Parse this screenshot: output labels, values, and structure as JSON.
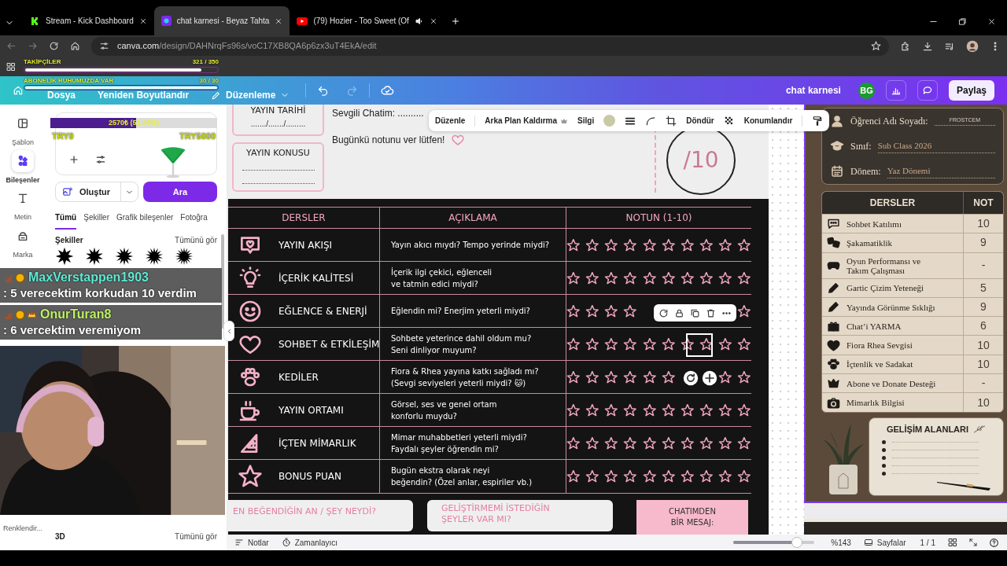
{
  "browser": {
    "tabs": [
      {
        "title": "Stream - Kick Dashboard",
        "selected": false,
        "audio": false
      },
      {
        "title": "chat karnesi - Beyaz Tahta",
        "selected": true,
        "audio": false
      },
      {
        "title": "(79) Hozier - Too Sweet (Of",
        "selected": false,
        "audio": true
      }
    ],
    "url_host": "canva.com",
    "url_path": "/design/DAHNrqFs96s/voC17XB8QA6p6zx3uT4EkA/edit"
  },
  "header": {
    "menu": [
      "Dosya",
      "Yeniden Boyutlandır",
      "Düzenleme"
    ],
    "design_title": "chat karnesi",
    "avatar": "BG",
    "share": "Paylaş"
  },
  "sidebar": {
    "items": [
      {
        "label": "Şablon",
        "selected": false
      },
      {
        "label": "Bileşenler",
        "selected": true
      },
      {
        "label": "Metin",
        "selected": false
      },
      {
        "label": "Marka",
        "selected": false
      },
      {
        "label": "Renklendir...",
        "selected": false
      }
    ]
  },
  "panel": {
    "create": "Oluştur",
    "search": "Ara",
    "tabs": [
      {
        "label": "Tümü",
        "selected": true
      },
      {
        "label": "Şekiller",
        "selected": false
      },
      {
        "label": "Grafik bileşenler",
        "selected": false
      },
      {
        "label": "Fotoğra",
        "selected": false
      }
    ],
    "sections": [
      {
        "title": "Şekiller",
        "link": "Tümünü gör"
      },
      {
        "title": "3D",
        "link": "Tümünü gör"
      }
    ]
  },
  "toolbar": {
    "items": [
      "Düzenle",
      "Arka Plan Kaldırma",
      "Silgi",
      "Döndür",
      "Konumlandır"
    ]
  },
  "sheet": {
    "date_label": "YAYIN TARİHİ",
    "date_blank": "......./......./.........",
    "topic_label": "YAYIN KONUSU",
    "greeting": "Sevgili Chatim: ..........",
    "prompt": "Bugünkü notunu ver lütfen!",
    "score": "/10",
    "columns": [
      "DERSLER",
      "AÇIKLAMA",
      "NOTUN (1-10)"
    ],
    "rows": [
      {
        "title": "YAYIN AKIŞI",
        "description": "Yayın akıcı mıydı? Tempo yerinde miydi?"
      },
      {
        "title": "İÇERİK KALİTESİ",
        "description": "İçerik ilgi çekici, eğlenceli\nve tatmin edici miydi?"
      },
      {
        "title": "EĞLENCE & ENERJİ",
        "description": "Eğlendin mi? Enerjim yeterli miydi?"
      },
      {
        "title": "SOHBET & ETKİLEŞİM",
        "description": "Sohbete yeterince dahil oldum mu?\nSeni dinliyor muyum?"
      },
      {
        "title": "KEDİLER",
        "description": "Fiora & Rhea yayına katkı sağladı mı?\n(Sevgi seviyeleri yeterli miydi? 🐱)"
      },
      {
        "title": "YAYIN ORTAMI",
        "description": "Görsel, ses ve genel ortam\nkonforlu muydu?"
      },
      {
        "title": "İÇTEN MİMARLIK",
        "description": "Mimar muhabbetleri yeterli miydi?\nFaydalı şeyler öğrendin mi?"
      },
      {
        "title": "BONUS PUAN",
        "description": "Bugün ekstra olarak neyi\nbeğendin? (Özel anlar, espiriler vb.)"
      }
    ],
    "cards": [
      "EN BEĞENDİĞİN AN / ŞEY NEYDİ?",
      "GELİŞTİRMEMİ İSTEDİĞİN\nŞEYLER VAR MI?",
      "CHATIMDEN\nBİR MESAJ:"
    ]
  },
  "report": {
    "fields": [
      {
        "label": "Öğrenci Adı Soyadı:",
        "value": "FROSTCEM"
      },
      {
        "label": "Sınıf:",
        "value": "Sub Class 2026"
      },
      {
        "label": "Dönem:",
        "value": "Yaz Dönemi"
      }
    ],
    "columns": [
      "DERSLER",
      "NOT"
    ],
    "rows": [
      {
        "subject": "Sohbet Katılımı",
        "grade": "10"
      },
      {
        "subject": "Şakamatiklik",
        "grade": "9"
      },
      {
        "subject": "Oyun Performansı ve\nTakım Çalışması",
        "grade": "-"
      },
      {
        "subject": "Gartic Çizim Yeteneği",
        "grade": "5"
      },
      {
        "subject": "Yayında Görünme Sıklığı",
        "grade": "9"
      },
      {
        "subject": "Chat’i YARMA",
        "grade": "6"
      },
      {
        "subject": "Fiora Rhea Sevgisi",
        "grade": "10"
      },
      {
        "subject": "İçtenlik ve Sadakat",
        "grade": "10"
      },
      {
        "subject": "Abone ve Donate Desteği",
        "grade": "-"
      },
      {
        "subject": "Mimarlık Bilgisi",
        "grade": "10"
      }
    ],
    "development_title": "GELİŞİM ALANLARI"
  },
  "footer": {
    "notes": "Notlar",
    "timer": "Zamanlayıcı",
    "zoom": {
      "level": 0.78
    },
    "zoom_reading": "%143",
    "pages": "Sayfalar",
    "page_count": "1 / 1"
  },
  "overlay": {
    "followers": {
      "label": "TAKİPÇİLER",
      "reading": "321 / 350",
      "level": 0.92
    },
    "subs": {
      "label": "ABONELİK RUHUMUZDA VAR",
      "reading": "30 / 30",
      "level": 1
    },
    "donation": {
      "reading": "2570₺ (51.40%)",
      "level": 0.514,
      "min": "TRY0",
      "max": "TRY5000"
    },
    "chat": [
      {
        "user": "MaxVerstappen1903",
        "message": ": 5 verecektim korkudan 10 verdim",
        "color": "#5eead4"
      },
      {
        "user": "OnurTuran8",
        "message": ": 6 vercektim veremiyom",
        "color": "#bef264"
      }
    ]
  }
}
